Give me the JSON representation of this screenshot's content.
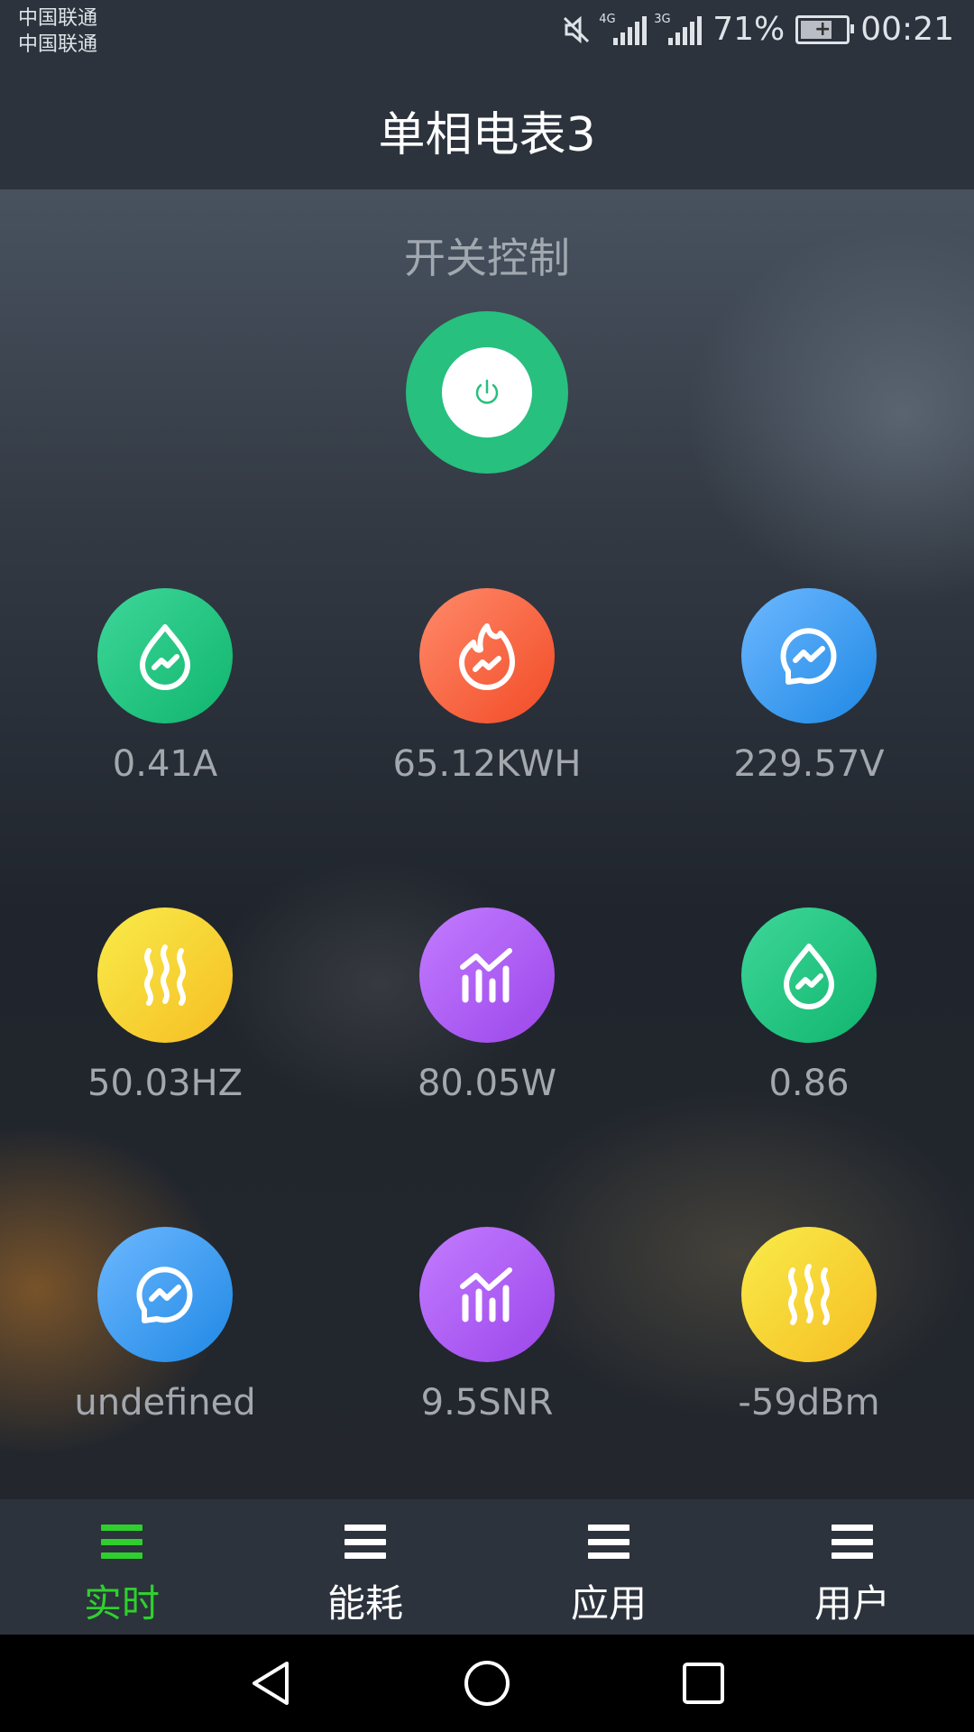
{
  "status_bar": {
    "carrier_1": "中国联通",
    "carrier_2": "中国联通",
    "signal_1_tag": "4G",
    "signal_2_tag": "3G",
    "battery_percent": "71%",
    "time": "00:21",
    "icons": [
      "mute-icon",
      "signal-icon",
      "signal-icon",
      "battery-charging-icon"
    ]
  },
  "header": {
    "title": "单相电表3"
  },
  "switch_control": {
    "title": "开关控制",
    "icon": "power-icon",
    "accent": "#27c07e"
  },
  "metrics": [
    {
      "value": "0.41A",
      "icon": "drop-trend-icon",
      "color": "#1fc47f"
    },
    {
      "value": "65.12KWH",
      "icon": "flame-trend-icon",
      "color": "#f85f3a"
    },
    {
      "value": "229.57V",
      "icon": "circle-trend-icon",
      "color": "#3d9cf2"
    },
    {
      "value": "50.03HZ",
      "icon": "heat-waves-icon",
      "color": "#f7d533"
    },
    {
      "value": "80.05W",
      "icon": "bar-chart-icon",
      "color": "#ac5ff2"
    },
    {
      "value": "0.86",
      "icon": "drop-trend-icon",
      "color": "#1fc47f"
    },
    {
      "value": "undefined",
      "icon": "circle-trend-icon",
      "color": "#3d9cf2"
    },
    {
      "value": "9.5SNR",
      "icon": "bar-chart-icon",
      "color": "#ac5ff2"
    },
    {
      "value": "-59dBm",
      "icon": "heat-waves-icon",
      "color": "#f7d533"
    }
  ],
  "tabs": [
    {
      "label": "实时",
      "active": true
    },
    {
      "label": "能耗",
      "active": false
    },
    {
      "label": "应用",
      "active": false
    },
    {
      "label": "用户",
      "active": false
    }
  ],
  "colors": {
    "active_tab": "#2fd02d",
    "bar_bg": "#2c333d"
  }
}
